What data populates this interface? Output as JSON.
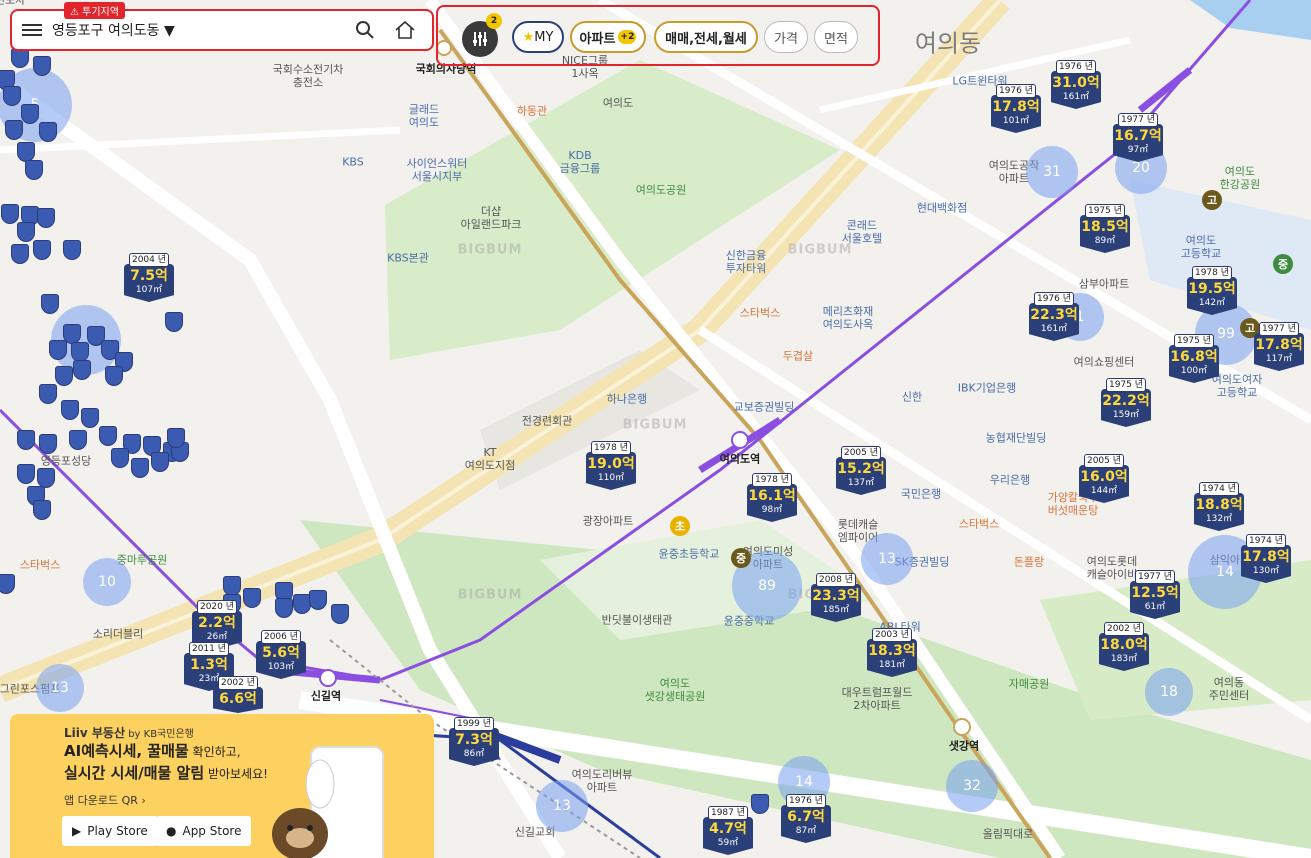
{
  "search": {
    "zone_badge": "투기지역",
    "location": "영등포구 여의도동",
    "filter_count": "2"
  },
  "filters": {
    "my": "MY",
    "apartment": "아파트",
    "apartment_count": "+2",
    "trade_type": "매매,전세,월세",
    "price": "가격",
    "area": "면적"
  },
  "colors": {
    "accent_red": "#e0262c",
    "marker_navy": "#2b3f78",
    "price_yellow": "#ffd83a"
  },
  "map_labels": [
    {
      "t": "여의동",
      "c": "big"
    },
    {
      "t": "국회수소전기차\n충전소"
    },
    {
      "t": "국회의사당역",
      "c": "dark"
    },
    {
      "t": "NICE그룹\n1사옥"
    },
    {
      "t": "하동관",
      "c": "orange"
    },
    {
      "t": "여의도"
    },
    {
      "t": "글래드\n여의도",
      "c": "blue"
    },
    {
      "t": "KBS",
      "c": "blue"
    },
    {
      "t": "사이언스워터\n서울시지부",
      "c": "blue"
    },
    {
      "t": "KDB\n금융그룹",
      "c": "blue"
    },
    {
      "t": "여의도공원",
      "c": "green"
    },
    {
      "t": "더샵\n아일랜드파크"
    },
    {
      "t": "KBS본관",
      "c": "blue"
    },
    {
      "t": "LG트윈타워",
      "c": "blue"
    },
    {
      "t": "현대백화점",
      "c": "blue"
    },
    {
      "t": "콘래드\n서울호텔",
      "c": "blue"
    },
    {
      "t": "신한금융\n투자타워",
      "c": "blue"
    },
    {
      "t": "스타벅스",
      "c": "orange"
    },
    {
      "t": "메리츠화재\n여의도사옥",
      "c": "blue"
    },
    {
      "t": "두겹살",
      "c": "orange"
    },
    {
      "t": "하나은행",
      "c": "blue"
    },
    {
      "t": "전경련회관"
    },
    {
      "t": "교보증권빌딩",
      "c": "blue"
    },
    {
      "t": "KT\n여의도지점"
    },
    {
      "t": "여의도역",
      "c": "dark"
    },
    {
      "t": "신한",
      "c": "blue"
    },
    {
      "t": "IBK기업은행",
      "c": "blue"
    },
    {
      "t": "농협재단빌딩",
      "c": "blue"
    },
    {
      "t": "우리은행",
      "c": "blue"
    },
    {
      "t": "국민은행",
      "c": "blue"
    },
    {
      "t": "광장아파트"
    },
    {
      "t": "윤중초등학교",
      "c": "blue"
    },
    {
      "t": "롯데캐슬\n엠파이어"
    },
    {
      "t": "SK증권빌딩",
      "c": "blue"
    },
    {
      "t": "여의도미성\n아파트"
    },
    {
      "t": "윤중중학교",
      "c": "blue"
    },
    {
      "t": "반딧불이생태관"
    },
    {
      "t": "ABL타워",
      "c": "blue"
    },
    {
      "t": "여의도\n샛강생태공원",
      "c": "green"
    },
    {
      "t": "대우트럼프월드\n2차아파트"
    },
    {
      "t": "샛강역",
      "c": "dark"
    },
    {
      "t": "여의도리버뷰\n아파트"
    },
    {
      "t": "올림픽대로"
    },
    {
      "t": "신길교회"
    },
    {
      "t": "신길역",
      "c": "dark"
    },
    {
      "t": "영등포성당"
    },
    {
      "t": "중마루공원",
      "c": "green"
    },
    {
      "t": "소리더블리"
    },
    {
      "t": "삼부아파트"
    },
    {
      "t": "여의도\n고등학교",
      "c": "blue"
    },
    {
      "t": "여의쇼핑센터"
    },
    {
      "t": "여의도여자\n고등학교",
      "c": "blue"
    },
    {
      "t": "여의도\n한강공원",
      "c": "green"
    },
    {
      "t": "여의도공작\n아파트"
    },
    {
      "t": "스타벅스",
      "c": "orange"
    },
    {
      "t": "돈플랑",
      "c": "orange"
    },
    {
      "t": "가양칼국수\n버섯매운탕",
      "c": "orange"
    },
    {
      "t": "자매공원",
      "c": "green"
    },
    {
      "t": "여의동\n주민센터"
    },
    {
      "t": "여의도롯데\n캐슬아이비"
    },
    {
      "t": "삼익아파트"
    },
    {
      "t": "스타벅스",
      "c": "orange"
    },
    {
      "t": "그린포스펌프"
    },
    {
      "t": "이고전포차"
    }
  ],
  "clusters": [
    "5",
    "31",
    "20",
    "1",
    "99",
    "14",
    "89",
    "13",
    "10",
    "13",
    "13",
    "32",
    "14",
    "18"
  ],
  "markers": [
    {
      "year": "2004 년",
      "price": "7.5억",
      "area": "107㎡"
    },
    {
      "year": "1976 년",
      "price": "31.0억",
      "area": "161㎡"
    },
    {
      "year": "1976 년",
      "price": "17.8억",
      "area": "101㎡"
    },
    {
      "year": "1977 년",
      "price": "16.7억",
      "area": "97㎡"
    },
    {
      "year": "1975 년",
      "price": "18.5억",
      "area": "89㎡"
    },
    {
      "year": "1978 년",
      "price": "19.5억",
      "area": "142㎡"
    },
    {
      "year": "1976 년",
      "price": "22.3억",
      "area": "161㎡"
    },
    {
      "year": "1975 년",
      "price": "16.8억",
      "area": "100㎡"
    },
    {
      "year": "1977 년",
      "price": "17.8억",
      "area": "117㎡"
    },
    {
      "year": "1975 년",
      "price": "22.2억",
      "area": "159㎡"
    },
    {
      "year": "2005 년",
      "price": "16.0억",
      "area": "144㎡"
    },
    {
      "year": "1974 년",
      "price": "18.8억",
      "area": "132㎡"
    },
    {
      "year": "1974 년",
      "price": "17.8억",
      "area": "130㎡"
    },
    {
      "year": "1977 년",
      "price": "12.5억",
      "area": "61㎡"
    },
    {
      "year": "2002 년",
      "price": "18.0억",
      "area": "183㎡"
    },
    {
      "year": "1978 년",
      "price": "19.0억",
      "area": "110㎡"
    },
    {
      "year": "1978 년",
      "price": "16.1억",
      "area": "98㎡"
    },
    {
      "year": "2005 년",
      "price": "15.2억",
      "area": "137㎡"
    },
    {
      "year": "2008 년",
      "price": "23.3억",
      "area": "185㎡"
    },
    {
      "year": "2003 년",
      "price": "18.3억",
      "area": "181㎡"
    },
    {
      "year": "2020 년",
      "price": "2.2억",
      "area": "26㎡"
    },
    {
      "year": "2006 년",
      "price": "5.6억",
      "area": "103㎡"
    },
    {
      "year": "2011 년",
      "price": "1.3억",
      "area": "23㎡"
    },
    {
      "year": "2002 년",
      "price": "6.6억",
      "area": ""
    },
    {
      "year": "1999 년",
      "price": "7.3억",
      "area": "86㎡"
    },
    {
      "year": "1987 년",
      "price": "4.7억",
      "area": "59㎡"
    },
    {
      "year": "1976 년",
      "price": "6.7억",
      "area": "87㎡"
    }
  ],
  "watermark": "BIGBUM",
  "ad": {
    "brand": "Liiv 부동산",
    "brand_sub": "by KB국민은행",
    "line1_bold": "AI예측시세, 꿀매물",
    "line1_rest": " 확인하고,",
    "line2_bold": "실시간 시세/매물 알림",
    "line2_rest": " 받아보세요!",
    "qr": "앱 다운로드 QR  ›",
    "play_store": "Play Store",
    "app_store": "App Store"
  }
}
